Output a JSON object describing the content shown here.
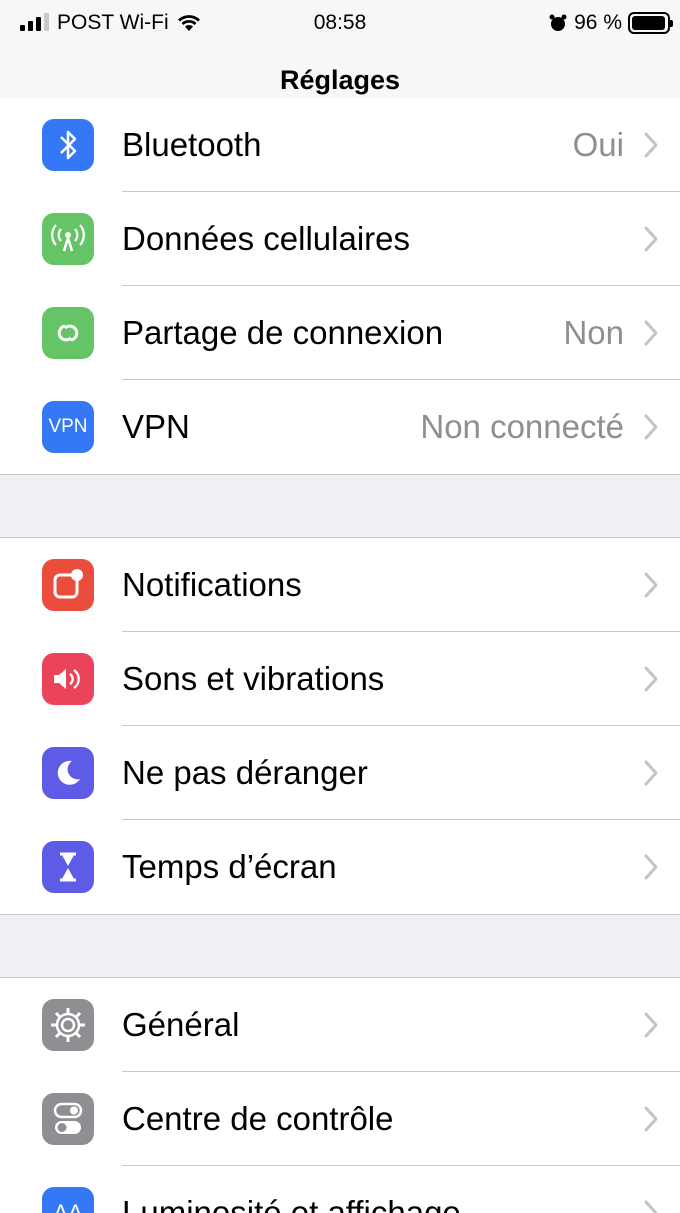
{
  "status_bar": {
    "carrier": "POST Wi-Fi",
    "time": "08:58",
    "battery_text": "96 %",
    "battery_level": 0.96
  },
  "nav": {
    "title": "Réglages"
  },
  "groups": [
    {
      "rows": [
        {
          "label": "Bluetooth",
          "value": "Oui",
          "icon": "bluetooth-icon",
          "color": "#3478f6"
        },
        {
          "label": "Données cellulaires",
          "value": "",
          "icon": "antenna-icon",
          "color": "#65c466"
        },
        {
          "label": "Partage de connexion",
          "value": "Non",
          "icon": "chain-link-icon",
          "color": "#65c466"
        },
        {
          "label": "VPN",
          "value": "Non connecté",
          "icon": "vpn-icon",
          "color": "#3478f6",
          "icon_text": "VPN"
        }
      ]
    },
    {
      "rows": [
        {
          "label": "Notifications",
          "value": "",
          "icon": "notifications-icon",
          "color": "#eb4d3d"
        },
        {
          "label": "Sons et vibrations",
          "value": "",
          "icon": "speaker-icon",
          "color": "#eb445a"
        },
        {
          "label": "Ne pas déranger",
          "value": "",
          "icon": "moon-icon",
          "color": "#5e5ce6"
        },
        {
          "label": "Temps d’écran",
          "value": "",
          "icon": "hourglass-icon",
          "color": "#5e5ce6"
        }
      ]
    },
    {
      "rows": [
        {
          "label": "Général",
          "value": "",
          "icon": "gear-icon",
          "color": "#8e8e93"
        },
        {
          "label": "Centre de contrôle",
          "value": "",
          "icon": "toggles-icon",
          "color": "#8e8e93"
        },
        {
          "label": "Luminosité et affichage",
          "value": "",
          "icon": "display-icon",
          "color": "#3478f6",
          "icon_text": "AA"
        }
      ]
    }
  ]
}
